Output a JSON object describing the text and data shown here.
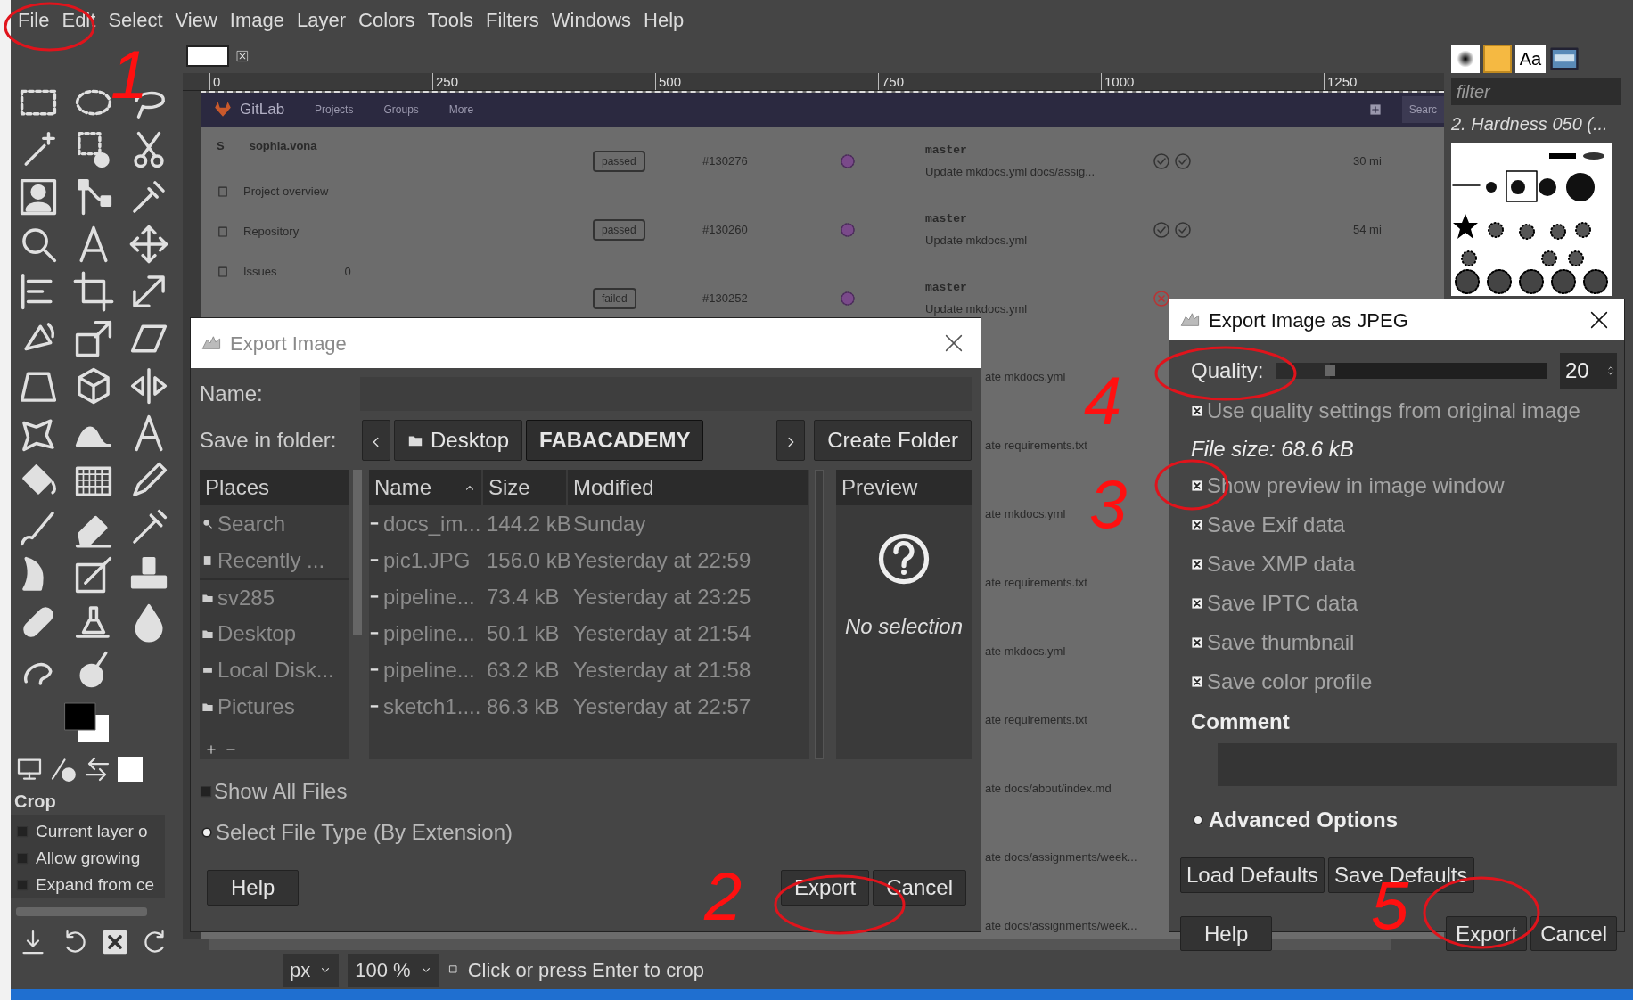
{
  "menu": [
    "File",
    "Edit",
    "Select",
    "View",
    "Image",
    "Layer",
    "Colors",
    "Tools",
    "Filters",
    "Windows",
    "Help"
  ],
  "ruler": [
    "0",
    "250",
    "500",
    "750",
    "1000",
    "1250"
  ],
  "gitlab": {
    "logo": "GitLab",
    "nav": [
      "Projects",
      "Groups",
      "More"
    ],
    "search": "Searc",
    "sidebar": [
      {
        "kind": "user",
        "avatar": "S",
        "label": "sophia.vona"
      },
      {
        "kind": "link",
        "label": "Project overview"
      },
      {
        "kind": "link",
        "label": "Repository"
      },
      {
        "kind": "link",
        "label": "Issues",
        "count": "0"
      }
    ],
    "pipelines": [
      {
        "status": "passed",
        "id": "#130276",
        "branch": "master",
        "commit": "Update mkdocs.yml  docs/assig...",
        "stages": [
          {
            "passed": true
          },
          {
            "passed": true
          }
        ],
        "time": "30 mi"
      },
      {
        "status": "passed",
        "id": "#130260",
        "branch": "master",
        "commit": "Update mkdocs.yml",
        "stages": [
          {
            "passed": true
          },
          {
            "passed": true
          }
        ],
        "time": "54 mi"
      },
      {
        "status": "failed",
        "id": "#130252",
        "branch": "master",
        "commit": "Update mkdocs.yml",
        "stages": [
          {
            "passed": false
          }
        ]
      }
    ],
    "covered_rows": [
      "ate mkdocs.yml",
      "ate requirements.txt",
      "ate mkdocs.yml",
      "ate requirements.txt",
      "ate mkdocs.yml",
      "ate requirements.txt",
      "ate docs/about/index.md",
      "ate docs/assignments/week...",
      "ate docs/assignments/week..."
    ]
  },
  "tool_options": {
    "title": "Crop",
    "options": [
      {
        "label": "Current layer o",
        "checked": false
      },
      {
        "label": "Allow growing",
        "checked": false
      },
      {
        "label": "Expand from ce",
        "checked": false
      }
    ]
  },
  "status_bar": {
    "unit": "px",
    "zoom": "100 %",
    "message": "Click or press Enter to crop"
  },
  "brushes": {
    "font_tab": "Aa",
    "filter_placeholder": "filter",
    "brush_name": "2. Hardness 050 (..."
  },
  "export_dialog": {
    "title": "Export Image",
    "name_label": "Name:",
    "folder_label": "Save in folder:",
    "path": [
      {
        "label": "Desktop",
        "selected": false
      },
      {
        "label": "FABACADEMY",
        "selected": true
      }
    ],
    "create_folder": "Create Folder",
    "places_header": "Places",
    "places": [
      {
        "kind": "search",
        "label": "Search"
      },
      {
        "kind": "recent",
        "label": "Recently ..."
      },
      {
        "kind": "folder",
        "label": "sv285"
      },
      {
        "kind": "folder",
        "label": "Desktop"
      },
      {
        "kind": "disk",
        "label": "Local Disk..."
      },
      {
        "kind": "folder",
        "label": "Pictures"
      }
    ],
    "columns": [
      "Name",
      "Size",
      "Modified"
    ],
    "files": [
      {
        "name": "docs_im...",
        "size": "144.2 kB",
        "modified": "Sunday"
      },
      {
        "name": "pic1.JPG",
        "size": "156.0 kB",
        "modified": "Yesterday at 22:59"
      },
      {
        "name": "pipeline...",
        "size": "73.4 kB",
        "modified": "Yesterday at 23:25"
      },
      {
        "name": "pipeline...",
        "size": "50.1 kB",
        "modified": "Yesterday at 21:54"
      },
      {
        "name": "pipeline...",
        "size": "63.2 kB",
        "modified": "Yesterday at 21:58"
      },
      {
        "name": "sketch1....",
        "size": "86.3 kB",
        "modified": "Yesterday at 22:57"
      }
    ],
    "preview_header": "Preview",
    "preview_text": "No selection",
    "show_all_files": {
      "label": "Show All Files",
      "checked": false
    },
    "file_type": {
      "label": "Select File Type (By Extension)",
      "expanded": false
    },
    "buttons": [
      "Help",
      "Export",
      "Cancel"
    ]
  },
  "jpeg_dialog": {
    "title": "Export Image as JPEG",
    "quality_label": "Quality:",
    "quality": "20",
    "level": 0.2,
    "use_original": {
      "label": "Use quality settings from original image",
      "checked": true
    },
    "file_size": "File size: 68.6 kB",
    "options": [
      {
        "label": "Show preview in image window",
        "checked": true
      },
      {
        "label": "Save Exif data",
        "checked": true
      },
      {
        "label": "Save XMP data",
        "checked": true
      },
      {
        "label": "Save IPTC data",
        "checked": true
      },
      {
        "label": "Save thumbnail",
        "checked": true
      },
      {
        "label": "Save color profile",
        "checked": true
      }
    ],
    "comment_label": "Comment",
    "advanced": {
      "label": "Advanced Options",
      "expanded": false
    },
    "defaults_buttons": [
      "Load Defaults",
      "Save Defaults"
    ],
    "buttons": [
      "Help",
      "Export",
      "Cancel"
    ]
  },
  "annotations": [
    {
      "text": "1"
    },
    {
      "text": "2"
    },
    {
      "text": "3"
    },
    {
      "text": "4"
    },
    {
      "text": "5"
    }
  ]
}
